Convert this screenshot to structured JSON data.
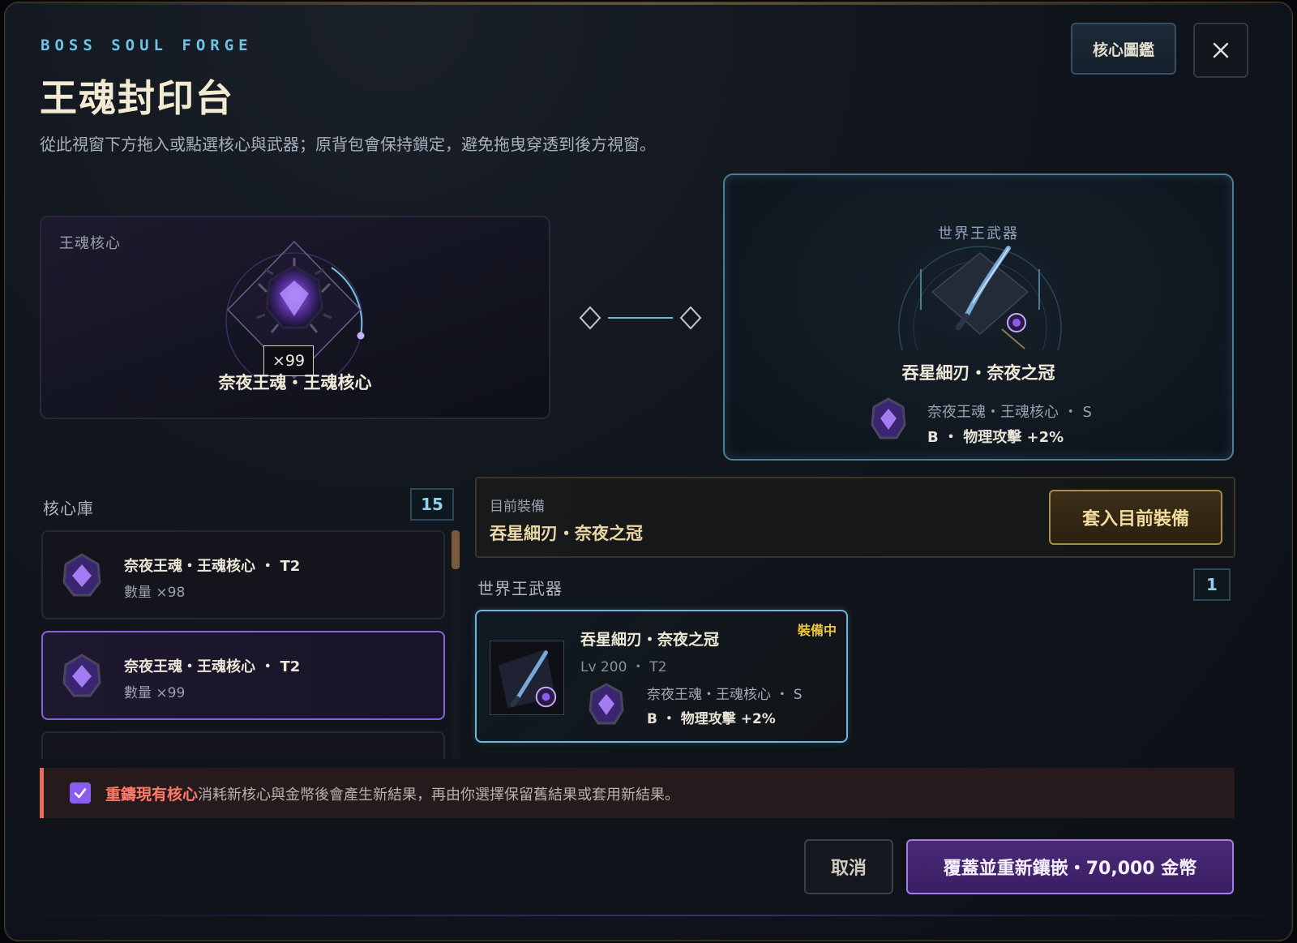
{
  "header": {
    "eyebrow": "BOSS SOUL FORGE",
    "title": "王魂封印台",
    "subtitle": "從此視窗下方拖入或點選核心與武器；原背包會保持鎖定，避免拖曳穿透到後方視窗。",
    "codex_label": "核心圖鑑"
  },
  "core_slot": {
    "label": "王魂核心",
    "quantity": "×99",
    "name": "奈夜王魂・王魂核心"
  },
  "weapon_slot": {
    "label": "世界王武器",
    "name": "吞星細刃・奈夜之冠",
    "core_line": "奈夜王魂・王魂核心 ・ S",
    "stat_line": "B ・ 物理攻擊 +2%"
  },
  "core_library": {
    "title": "核心庫",
    "count": "15",
    "items": [
      {
        "name": "奈夜王魂・王魂核心 ・ T2",
        "qty": "數量 ×98",
        "selected": false
      },
      {
        "name": "奈夜王魂・王魂核心 ・ T2",
        "qty": "數量 ×99",
        "selected": true
      }
    ]
  },
  "current_equipment": {
    "label": "目前裝備",
    "value": "吞星細刃・奈夜之冠",
    "apply_label": "套入目前裝備"
  },
  "weapon_library": {
    "title": "世界王武器",
    "count": "1",
    "items": [
      {
        "badge": "裝備中",
        "name": "吞星細刃・奈夜之冠",
        "level": "Lv 200 ・ T2",
        "core_line": "奈夜王魂・王魂核心 ・ S",
        "stat_line": "B ・ 物理攻擊 +2%"
      }
    ]
  },
  "reforge": {
    "checked": true,
    "emphasis": "重鑄現有核心",
    "text": "消耗新核心與金幣後會產生新結果，再由你選擇保留舊結果或套用新結果。"
  },
  "footer": {
    "cancel_label": "取消",
    "confirm_label": "覆蓋並重新鑲嵌・70,000 金幣"
  },
  "colors": {
    "accent_purple": "#8a62d8",
    "accent_cyan": "#6fb6dc",
    "accent_gold": "#a88a4a",
    "warning_red": "#e86a5c"
  }
}
